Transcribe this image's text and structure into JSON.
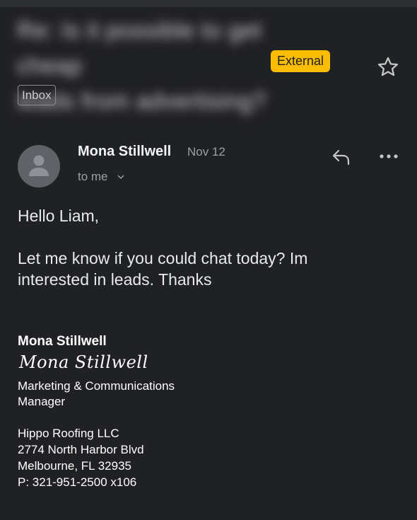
{
  "subject": {
    "line1": "Re: Is it possible to get cheap",
    "line2": "leads from advertising?"
  },
  "external_label": "External",
  "label_chip": "Inbox",
  "sender": {
    "name": "Mona Stillwell",
    "date": "Nov 12",
    "recipient": "to me"
  },
  "body": {
    "greeting": "Hello Liam,",
    "line1": "Let me know if you could chat today? Im",
    "line2": "interested in leads. Thanks"
  },
  "signature": {
    "name": "Mona Stillwell",
    "script_name": "Mona Stillwell",
    "title1": "Marketing & Communications",
    "title2": "Manager",
    "company": "Hippo Roofing LLC",
    "address1": "2774 North Harbor Blvd",
    "address2": "Melbourne, FL 32935",
    "phone": "P: 321-951-2500 x106"
  },
  "icons": {
    "star": "star-icon",
    "reply": "reply-icon",
    "more": "more-options-icon",
    "chevron": "chevron-down-icon",
    "avatar": "person-icon"
  },
  "colors": {
    "background": "#202124",
    "external_badge": "#fbbc04"
  }
}
